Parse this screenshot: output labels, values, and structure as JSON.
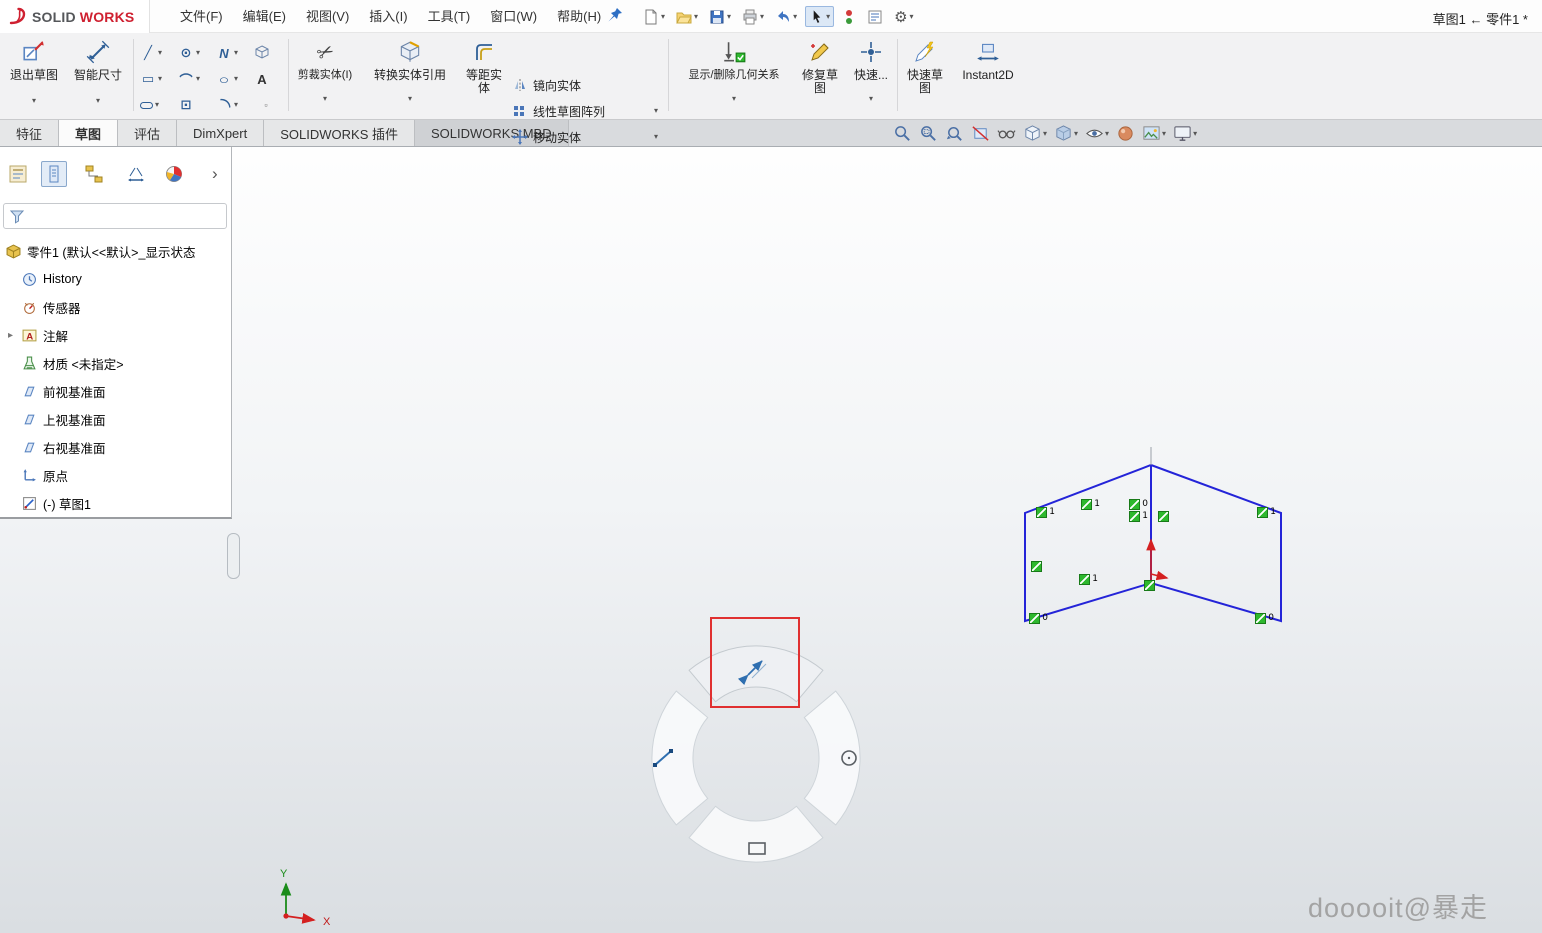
{
  "brand": {
    "prefix": "SOLID",
    "suffix": "WORKS"
  },
  "menubar": {
    "menus": [
      "文件(F)",
      "编辑(E)",
      "视图(V)",
      "插入(I)",
      "工具(T)",
      "窗口(W)",
      "帮助(H)"
    ],
    "document_title": "草图1 ← 零件1 *"
  },
  "ribbon": {
    "exit_sketch": "退出草图",
    "smart_dimension": "智能尺寸",
    "trim_entities": "剪裁实体(I)",
    "convert_entities": "转换实体引用",
    "offset_entities": "等距实体",
    "mirror_entities": "镜向实体",
    "linear_sketch_pattern": "线性草图阵列",
    "move_entities": "移动实体",
    "display_delete_relations": "显示/删除几何关系",
    "repair_sketch": "修复草图",
    "quick_snaps": "快速...",
    "rapid_sketch": "快速草图",
    "instant2d": "Instant2D"
  },
  "tabs": [
    "特征",
    "草图",
    "评估",
    "DimXpert",
    "SOLIDWORKS 插件",
    "SOLIDWORKS MBD"
  ],
  "feature_tree": {
    "root": "零件1 (默认<<默认>_显示状态",
    "items": [
      "History",
      "传感器",
      "注解",
      "材质 <未指定>",
      "前视基准面",
      "上视基准面",
      "右视基准面",
      "原点",
      "(-) 草图1"
    ]
  },
  "sketch_badges": [
    {
      "n": "1"
    },
    {
      "n": "1"
    },
    {
      "n": "0"
    },
    {
      "n": "1"
    },
    {
      "n": ""
    },
    {
      "n": "1"
    },
    {
      "n": ""
    },
    {
      "n": "1"
    },
    {
      "n": ""
    },
    {
      "n": "0"
    },
    {
      "n": "0"
    }
  ],
  "triad": {
    "x_label": "X",
    "y_label": "Y"
  },
  "watermark": "dooooit@暴走",
  "icons": {
    "caret": "▾",
    "gear": "⚙",
    "scissors": "✂",
    "line": "╱",
    "circle": "⊙",
    "spline": "N",
    "rect": "▭",
    "arc": "⌒",
    "ellipse": "○",
    "text_tool": "A",
    "point": "▫",
    "squared_dot": "⊡",
    "chevron_right": "›",
    "expand": "▸"
  },
  "colors": {
    "annotation_red": "#e03030",
    "sketch_blue": "#2424d8",
    "constraint_green": "#2eb82e"
  }
}
